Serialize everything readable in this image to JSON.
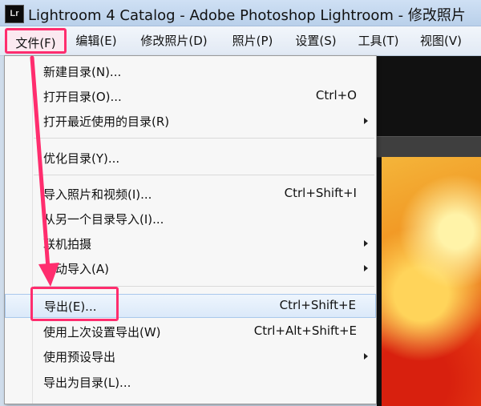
{
  "window": {
    "icon_text": "Lr",
    "title": "Lightroom 4 Catalog - Adobe Photoshop Lightroom - 修改照片"
  },
  "menubar": {
    "items": [
      {
        "label": "文件(F)"
      },
      {
        "label": "编辑(E)"
      },
      {
        "label": "修改照片(D)"
      },
      {
        "label": "照片(P)"
      },
      {
        "label": "设置(S)"
      },
      {
        "label": "工具(T)"
      },
      {
        "label": "视图(V)"
      }
    ]
  },
  "file_menu": {
    "items": [
      {
        "label": "新建目录(N)...",
        "shortcut": ""
      },
      {
        "label": "打开目录(O)...",
        "shortcut": "Ctrl+O"
      },
      {
        "label": "打开最近使用的目录(R)",
        "shortcut": "",
        "submenu": true
      },
      {
        "label": "优化目录(Y)...",
        "shortcut": ""
      },
      {
        "label": "导入照片和视频(I)...",
        "shortcut": "Ctrl+Shift+I"
      },
      {
        "label": "从另一个目录导入(I)...",
        "shortcut": ""
      },
      {
        "label": "联机拍摄",
        "shortcut": "",
        "submenu": true
      },
      {
        "label": "自动导入(A)",
        "shortcut": "",
        "submenu": true
      },
      {
        "label": "导出(E)...",
        "shortcut": "Ctrl+Shift+E",
        "highlighted": true
      },
      {
        "label": "使用上次设置导出(W)",
        "shortcut": "Ctrl+Alt+Shift+E"
      },
      {
        "label": "使用预设导出",
        "shortcut": "",
        "submenu": true
      },
      {
        "label": "导出为目录(L)...",
        "shortcut": ""
      }
    ]
  },
  "colors": {
    "annotation": "#ff2d6e",
    "highlight": "#dbe9f9"
  }
}
